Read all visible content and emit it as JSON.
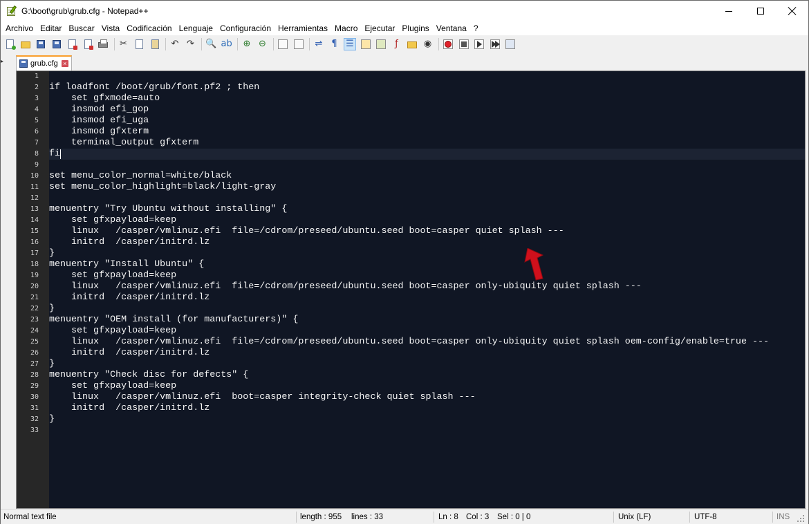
{
  "window": {
    "title": "G:\\boot\\grub\\grub.cfg - Notepad++",
    "icon": "notepad-plus-plus-icon"
  },
  "menu": [
    "Archivo",
    "Editar",
    "Buscar",
    "Vista",
    "Codificación",
    "Lenguaje",
    "Configuración",
    "Herramientas",
    "Macro",
    "Ejecutar",
    "Plugins",
    "Ventana",
    "?"
  ],
  "toolbar": {
    "buttons": [
      "new-file-icon",
      "open-file-icon",
      "save-icon",
      "save-all-icon",
      "close-icon",
      "close-all-icon",
      "print-icon",
      "cut-icon",
      "copy-icon",
      "paste-icon",
      "undo-icon",
      "redo-icon",
      "find-icon",
      "replace-icon",
      "zoom-in-icon",
      "zoom-out-icon",
      "sync-vertical-icon",
      "sync-horizontal-icon",
      "word-wrap-icon",
      "show-all-characters-icon",
      "indent-guide-icon",
      "user-defined-language-icon",
      "document-map-icon",
      "function-list-icon",
      "folder-as-workspace-icon",
      "monitoring-icon",
      "record-macro-icon",
      "stop-recording-icon",
      "playback-macro-icon",
      "run-macro-multiple-icon",
      "save-macro-icon"
    ],
    "active_button": "indent-guide-icon"
  },
  "tab": {
    "label": "grub.cfg",
    "icon": "saved-file-icon",
    "close_icon": "tab-close-icon"
  },
  "editor": {
    "current_line": 8,
    "lines": [
      "",
      "if loadfont /boot/grub/font.pf2 ; then",
      "    set gfxmode=auto",
      "    insmod efi_gop",
      "    insmod efi_uga",
      "    insmod gfxterm",
      "    terminal_output gfxterm",
      "fi",
      "",
      "set menu_color_normal=white/black",
      "set menu_color_highlight=black/light-gray",
      "",
      "menuentry \"Try Ubuntu without installing\" {",
      "    set gfxpayload=keep",
      "    linux   /casper/vmlinuz.efi  file=/cdrom/preseed/ubuntu.seed boot=casper quiet splash ---",
      "    initrd  /casper/initrd.lz",
      "}",
      "menuentry \"Install Ubuntu\" {",
      "    set gfxpayload=keep",
      "    linux   /casper/vmlinuz.efi  file=/cdrom/preseed/ubuntu.seed boot=casper only-ubiquity quiet splash ---",
      "    initrd  /casper/initrd.lz",
      "}",
      "menuentry \"OEM install (for manufacturers)\" {",
      "    set gfxpayload=keep",
      "    linux   /casper/vmlinuz.efi  file=/cdrom/preseed/ubuntu.seed boot=casper only-ubiquity quiet splash oem-config/enable=true ---",
      "    initrd  /casper/initrd.lz",
      "}",
      "menuentry \"Check disc for defects\" {",
      "    set gfxpayload=keep",
      "    linux   /casper/vmlinuz.efi  boot=casper integrity-check quiet splash ---",
      "    initrd  /casper/initrd.lz",
      "}",
      ""
    ]
  },
  "annotation": {
    "icon": "red-arrow-pointer-icon",
    "color": "#d0101c"
  },
  "statusbar": {
    "file_type": "Normal text file",
    "length": "length : 955",
    "lines": "lines : 33",
    "ln": "Ln : 8",
    "col": "Col : 3",
    "sel": "Sel : 0 | 0",
    "eol": "Unix (LF)",
    "encoding": "UTF-8",
    "mode": "INS"
  },
  "colors": {
    "editor_background": "#101624",
    "gutter_background": "#272727",
    "text": "#f5f5f5",
    "tab_accent": "#fa9e2c"
  }
}
